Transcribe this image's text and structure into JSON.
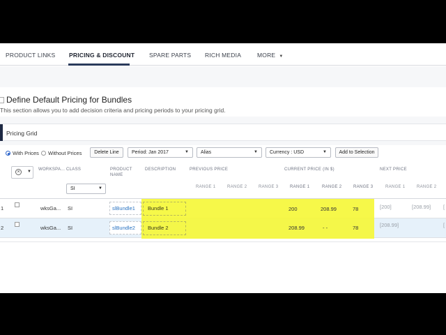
{
  "tabs": [
    {
      "label": "PRODUCT LINKS"
    },
    {
      "label": "PRICING & DISCOUNT"
    },
    {
      "label": "SPARE PARTS"
    },
    {
      "label": "RICH MEDIA"
    },
    {
      "label": "MORE"
    }
  ],
  "section": {
    "title": "Define Default Pricing for Bundles",
    "description": "This section allows you to add decision criteria and pricing periods to your pricing grid."
  },
  "grid": {
    "title": "Pricing Grid"
  },
  "toolbar": {
    "with_prices": "With Prices",
    "without_prices": "Without Prices",
    "delete_line": "Delete Line",
    "period": "Period:  Jan 2017",
    "alias": "Alias",
    "currency": "Currency :  USD",
    "add_to_selection": "Add to Selection"
  },
  "columns": {
    "workspace": "WORKSPA...",
    "class": "CLASS",
    "product_name_1": "PRODUCT",
    "product_name_2": "NAME",
    "description": "DESCRIPTION",
    "previous_price": "PREVIOUS PRICE",
    "current_price": "CURRENT PRICE (IN $)",
    "next_price": "NEXT PRICE",
    "range1": "RANGE 1",
    "range2": "RANGE 2",
    "range3": "RANGE 3"
  },
  "class_filter": "SI",
  "rows": [
    {
      "num": "1",
      "workspace": "wksGa...",
      "class": "SI",
      "product": "slBundle1",
      "description": "Bundle 1",
      "cur_r1": "200",
      "cur_r2": "208.99",
      "cur_r3": "78",
      "next_r1": "[200]",
      "next_r2": "[208.99]",
      "next_r3": "["
    },
    {
      "num": "2",
      "workspace": "wksGa...",
      "class": "SI",
      "product": "slBundle2",
      "description": "Bundle 2",
      "cur_r1": "208.99",
      "cur_r2": "- -",
      "cur_r3": "78",
      "next_r1": "[208.99]",
      "next_r2": "",
      "next_r3": "["
    }
  ],
  "colors": {
    "highlight": "#f5f73a",
    "accent": "#1f2a44",
    "link": "#2a73c2",
    "selected_row": "#e6f1fa"
  }
}
